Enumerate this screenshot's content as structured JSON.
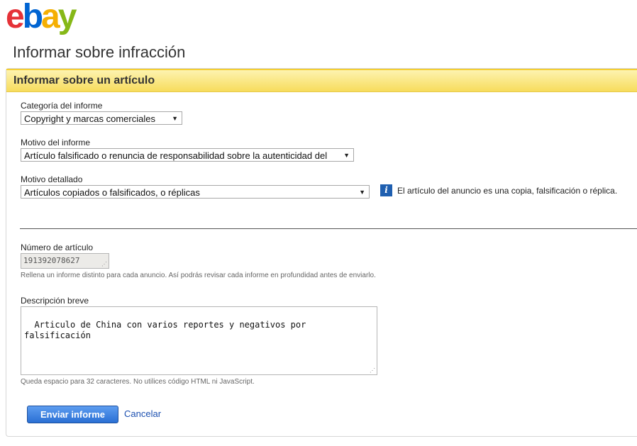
{
  "brand": {
    "logo_letters": [
      "e",
      "b",
      "a",
      "y"
    ],
    "colors": [
      "#e53238",
      "#0064d2",
      "#f5af02",
      "#86b817"
    ]
  },
  "page": {
    "title": "Informar sobre infracción"
  },
  "panel": {
    "header": "Informar sobre un artículo"
  },
  "form": {
    "category": {
      "label": "Categoría del informe",
      "value": "Copyright y marcas comerciales"
    },
    "reason": {
      "label": "Motivo del informe",
      "value": "Artículo falsificado o renuncia de responsabilidad sobre la autenticidad del"
    },
    "detailed": {
      "label": "Motivo detallado",
      "value": "Artículos copiados o falsificados, o réplicas"
    },
    "info": {
      "icon": "info-icon",
      "text": "El artículo del anuncio es una copia, falsificación o réplica."
    },
    "item_number": {
      "label": "Número de artículo",
      "value": "191392078627",
      "hint": "Rellena un informe distinto para cada anuncio. Así podrás revisar cada informe en profundidad antes de enviarlo."
    },
    "description": {
      "label": "Descripción breve",
      "value": "Articulo de China con varios reportes y negativos por\nfalsificación",
      "hint": "Queda espacio para 32 caracteres. No utilices código HTML ni JavaScript."
    }
  },
  "actions": {
    "submit": "Enviar informe",
    "cancel": "Cancelar"
  }
}
